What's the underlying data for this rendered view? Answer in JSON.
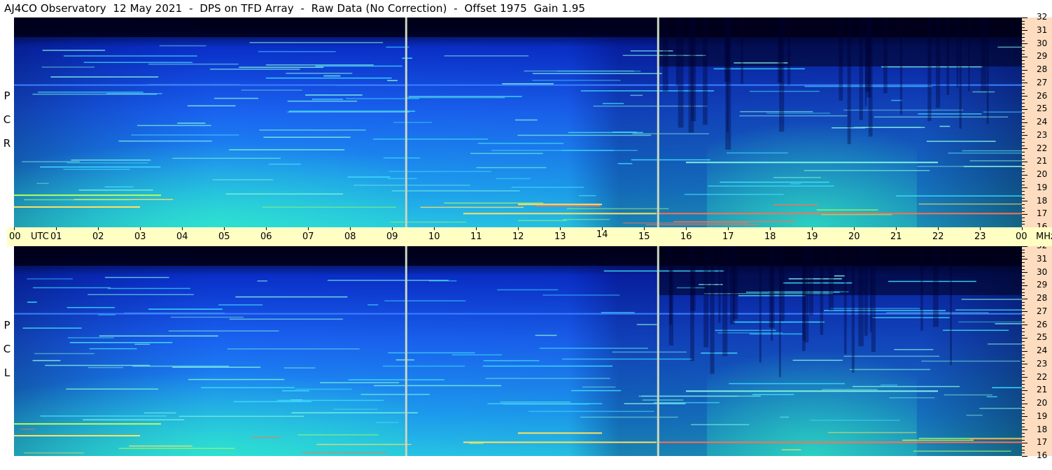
{
  "header": {
    "title": "AJ4CO Observatory  12 May 2021  -  DPS on TFD Array  -  Raw Data (No Correction)  -  Offset 1975  Gain 1.95"
  },
  "panels": {
    "top_label": [
      "R",
      "C",
      "P"
    ],
    "bottom_label": [
      "L",
      "C",
      "P"
    ]
  },
  "time_axis": {
    "unit_label": "UTC",
    "freq_unit": "MHz"
  },
  "colors": {
    "background": "#ffffff",
    "time_bar": "#ffffc4",
    "freq_bar": "#fddcbf",
    "spectrogram_low": "#000010",
    "spectrogram_mid": "#1a5cff",
    "spectrogram_high": "#2fe0d8",
    "interference": "#ff7050"
  },
  "chart_data": {
    "type": "heatmap",
    "title": "AJ4CO Observatory  12 May 2021  -  DPS on TFD Array  -  Raw Data (No Correction)  -  Offset 1975  Gain 1.95",
    "xlabel": "UTC",
    "ylabel": "MHz",
    "x_ticks": [
      "00",
      "01",
      "02",
      "03",
      "04",
      "05",
      "06",
      "07",
      "08",
      "09",
      "10",
      "11",
      "12",
      "13",
      "14",
      "15",
      "16",
      "17",
      "18",
      "19",
      "20",
      "21",
      "22",
      "23",
      "00"
    ],
    "y_ticks": [
      "16",
      "17",
      "18",
      "19",
      "20",
      "21",
      "22",
      "23",
      "24",
      "25",
      "26",
      "27",
      "28",
      "29",
      "30",
      "31",
      "32"
    ],
    "xlim_hours": [
      0,
      24
    ],
    "ylim_mhz": [
      16,
      32
    ],
    "panels": [
      "RCP",
      "LCP"
    ],
    "gaps_utc_hours": [
      9.33,
      15.33
    ]
  }
}
